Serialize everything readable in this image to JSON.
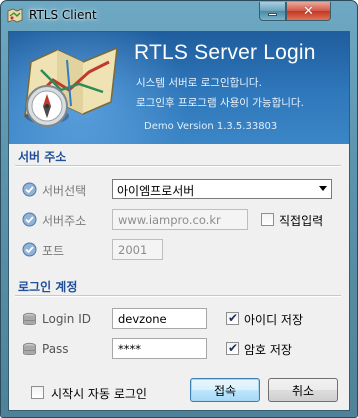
{
  "window": {
    "title": "RTLS Client",
    "minimize_glyph": "",
    "close_glyph": "✕"
  },
  "banner": {
    "title": "RTLS Server Login",
    "line1": "시스템 서버로 로그인합니다.",
    "line2": "로그인후 프로그램 사용이 가능합니다.",
    "version": "Demo Version 1.3.5.33803"
  },
  "server_section": {
    "title": "서버 주소",
    "select_label": "서버선택",
    "select_value": "아이엠프로서버",
    "address_label": "서버주소",
    "address_value": "www.iampro.co.kr",
    "direct_input_label": "직접입력",
    "direct_input_checked": false,
    "port_label": "포트",
    "port_value": "2001"
  },
  "login_section": {
    "title": "로그인 계정",
    "id_label": "Login ID",
    "id_value": "devzone",
    "save_id_label": "아이디 저장",
    "save_id_checked": true,
    "pass_label": "Pass",
    "pass_value": "****",
    "save_pass_label": "암호 저장",
    "save_pass_checked": true
  },
  "footer": {
    "auto_login_label": "시작시 자동 로그인",
    "auto_login_checked": false,
    "connect_label": "접속",
    "cancel_label": "취소"
  },
  "colors": {
    "banner": "#2f78bb",
    "section_title": "#1f4f9a",
    "window_frame": "#5c93ad",
    "close_button": "#c23822"
  },
  "icons": [
    "app-map-icon",
    "minimize-icon",
    "close-icon",
    "map-compass-icon",
    "check-circle-icon",
    "database-icon",
    "checkmark-icon",
    "dropdown-arrow-icon"
  ]
}
